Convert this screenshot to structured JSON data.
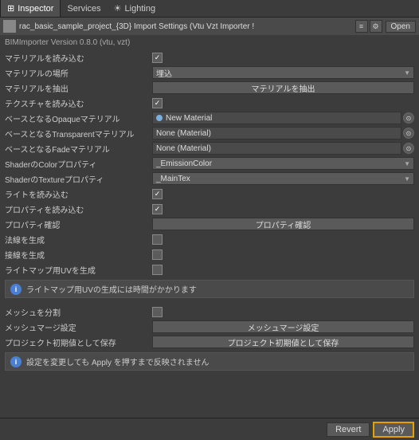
{
  "tabs": [
    {
      "id": "inspector",
      "label": "Inspector",
      "icon": "⊞",
      "active": true
    },
    {
      "id": "services",
      "label": "Services",
      "active": false
    },
    {
      "id": "lighting",
      "label": "Lighting",
      "icon": "☀",
      "active": false
    }
  ],
  "header": {
    "title": "rac_basic_sample_project_{3D} Import Settings (Vtu Vzt Importer !",
    "open_label": "Open"
  },
  "version": "BIMImporter Version 0.8.0 (vtu, vzt)",
  "rows": [
    {
      "label": "マテリアルを読み込む",
      "type": "checkbox",
      "checked": true
    },
    {
      "label": "マテリアルの場所",
      "type": "dropdown",
      "value": "埋込"
    },
    {
      "label": "マテリアルを抽出",
      "type": "button",
      "value": "マテリアルを抽出"
    },
    {
      "label": "テクスチャを読み込む",
      "type": "checkbox",
      "checked": true
    },
    {
      "label": "ベースとなるOpaqueマテリアル",
      "type": "object",
      "value": "New Material",
      "dot": true
    },
    {
      "label": "ベースとなるTransparentマテリアル",
      "type": "object",
      "value": "None (Material)",
      "dot": false
    },
    {
      "label": "ベースとなるFadeマテリアル",
      "type": "object",
      "value": "None (Material)",
      "dot": false
    },
    {
      "label": "ShaderのColorプロパティ",
      "type": "dropdown",
      "value": "_EmissionColor"
    },
    {
      "label": "ShaderのTextureプロパティ",
      "type": "dropdown",
      "value": "_MainTex"
    },
    {
      "label": "ライトを読み込む",
      "type": "checkbox",
      "checked": true
    },
    {
      "label": "プロパティを読み込む",
      "type": "checkbox",
      "checked": true
    },
    {
      "label": "プロパティ確認",
      "type": "button",
      "value": "プロパティ確認"
    },
    {
      "label": "法線を生成",
      "type": "checkbox",
      "checked": false
    },
    {
      "label": "接線を生成",
      "type": "checkbox",
      "checked": false
    },
    {
      "label": "ライトマップ用UVを生成",
      "type": "checkbox",
      "checked": false
    }
  ],
  "info1": "ライトマップ用UVの生成には時間がかかります",
  "rows2": [
    {
      "label": "メッシュを分割",
      "type": "checkbox",
      "checked": false
    },
    {
      "label": "メッシュマージ設定",
      "type": "button",
      "value": "メッシュマージ設定"
    },
    {
      "label": "プロジェクト初期値として保存",
      "type": "button",
      "value": "プロジェクト初期値として保存"
    }
  ],
  "info2": "設定を変更しても Apply を押すまで反映されません",
  "footer": {
    "revert_label": "Revert",
    "apply_label": "Apply"
  }
}
